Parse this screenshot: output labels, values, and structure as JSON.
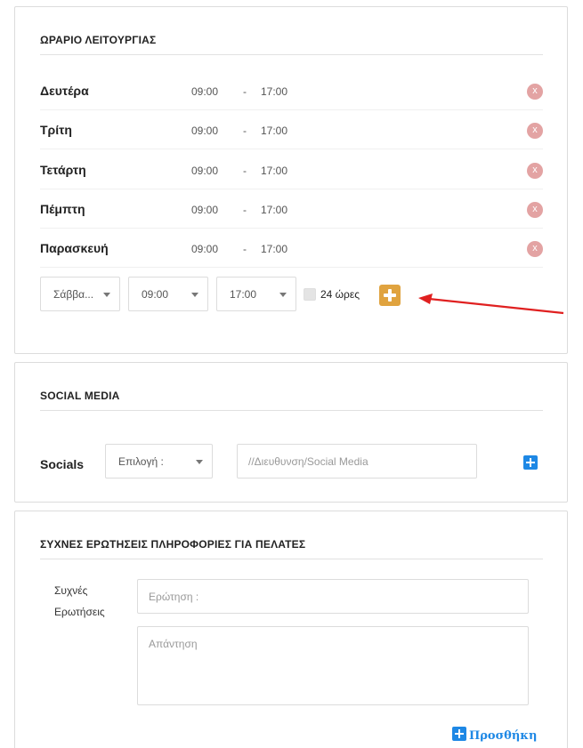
{
  "hours": {
    "title": "ΩΡΑΡΙΟ ΛΕΙΤΟΥΡΓΙΑΣ",
    "days": [
      {
        "name": "Δευτέρα",
        "from": "09:00",
        "dash": "-",
        "to": "17:00",
        "remove": "x"
      },
      {
        "name": "Τρίτη",
        "from": "09:00",
        "dash": "-",
        "to": "17:00",
        "remove": "x"
      },
      {
        "name": "Τετάρτη",
        "from": "09:00",
        "dash": "-",
        "to": "17:00",
        "remove": "x"
      },
      {
        "name": "Πέμπτη",
        "from": "09:00",
        "dash": "-",
        "to": "17:00",
        "remove": "x"
      },
      {
        "name": "Παρασκευή",
        "from": "09:00",
        "dash": "-",
        "to": "17:00",
        "remove": "x"
      }
    ],
    "new_entry": {
      "day_select": "Σάββα...",
      "from_select": "09:00",
      "to_select": "17:00",
      "all_day_label": "24 ώρες",
      "all_day_checked": false
    },
    "add_button_color": "#e0a33f"
  },
  "social": {
    "title": "SOCIAL MEDIA",
    "label": "Socials",
    "select": "Επιλογή :",
    "url_placeholder": "//Διευθυνση/Social Media"
  },
  "faq": {
    "title": "ΣΥΧΝΕΣ ΕΡΩΤΗΣΕΙΣ ΠΛΗΡΟΦΟΡΙΕΣ ΓΙΑ ΠΕΛΑΤΕΣ",
    "label_line1": "Συχνές",
    "label_line2": "Ερωτήσεις",
    "question_placeholder": "Ερώτηση :",
    "answer_placeholder": "Απάντηση",
    "add_label": "Προσθήκη"
  },
  "colors": {
    "accent_blue": "#1e88e5",
    "remove_red": "#e3a3a3",
    "annotation_arrow": "#e02020"
  }
}
